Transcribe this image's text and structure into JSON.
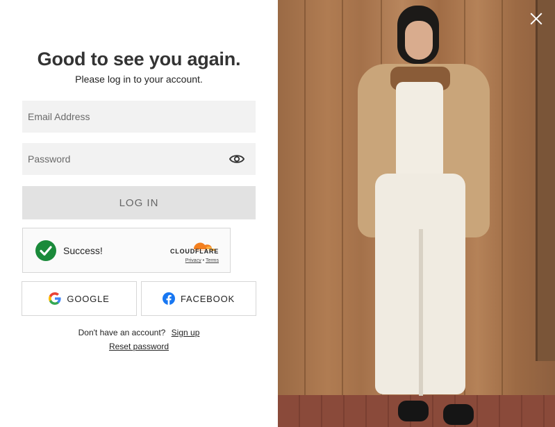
{
  "login": {
    "title": "Good to see you again.",
    "subtitle": "Please log in to your account.",
    "email_placeholder": "Email Address",
    "password_placeholder": "Password",
    "login_label": "LOG IN"
  },
  "captcha": {
    "status": "Success!",
    "brand": "CLOUDFLARE",
    "privacy": "Privacy",
    "separator": "•",
    "terms": "Terms"
  },
  "social": {
    "google_label": "GOOGLE",
    "facebook_label": "FACEBOOK"
  },
  "footer": {
    "signup_prompt": "Don't have an account?",
    "signup_link": "Sign up",
    "reset_link": "Reset password"
  },
  "icons": {
    "close": "close-icon",
    "eye": "eye-icon",
    "check": "check-circle-icon",
    "cloudflare": "cloudflare-logo",
    "google": "google-icon",
    "facebook": "facebook-icon"
  },
  "colors": {
    "success_green": "#1a8a3a",
    "cloudflare_orange": "#f38020",
    "facebook_blue": "#1877f2",
    "login_button_bg": "#e2e2e2",
    "input_bg": "#f2f2f2"
  }
}
